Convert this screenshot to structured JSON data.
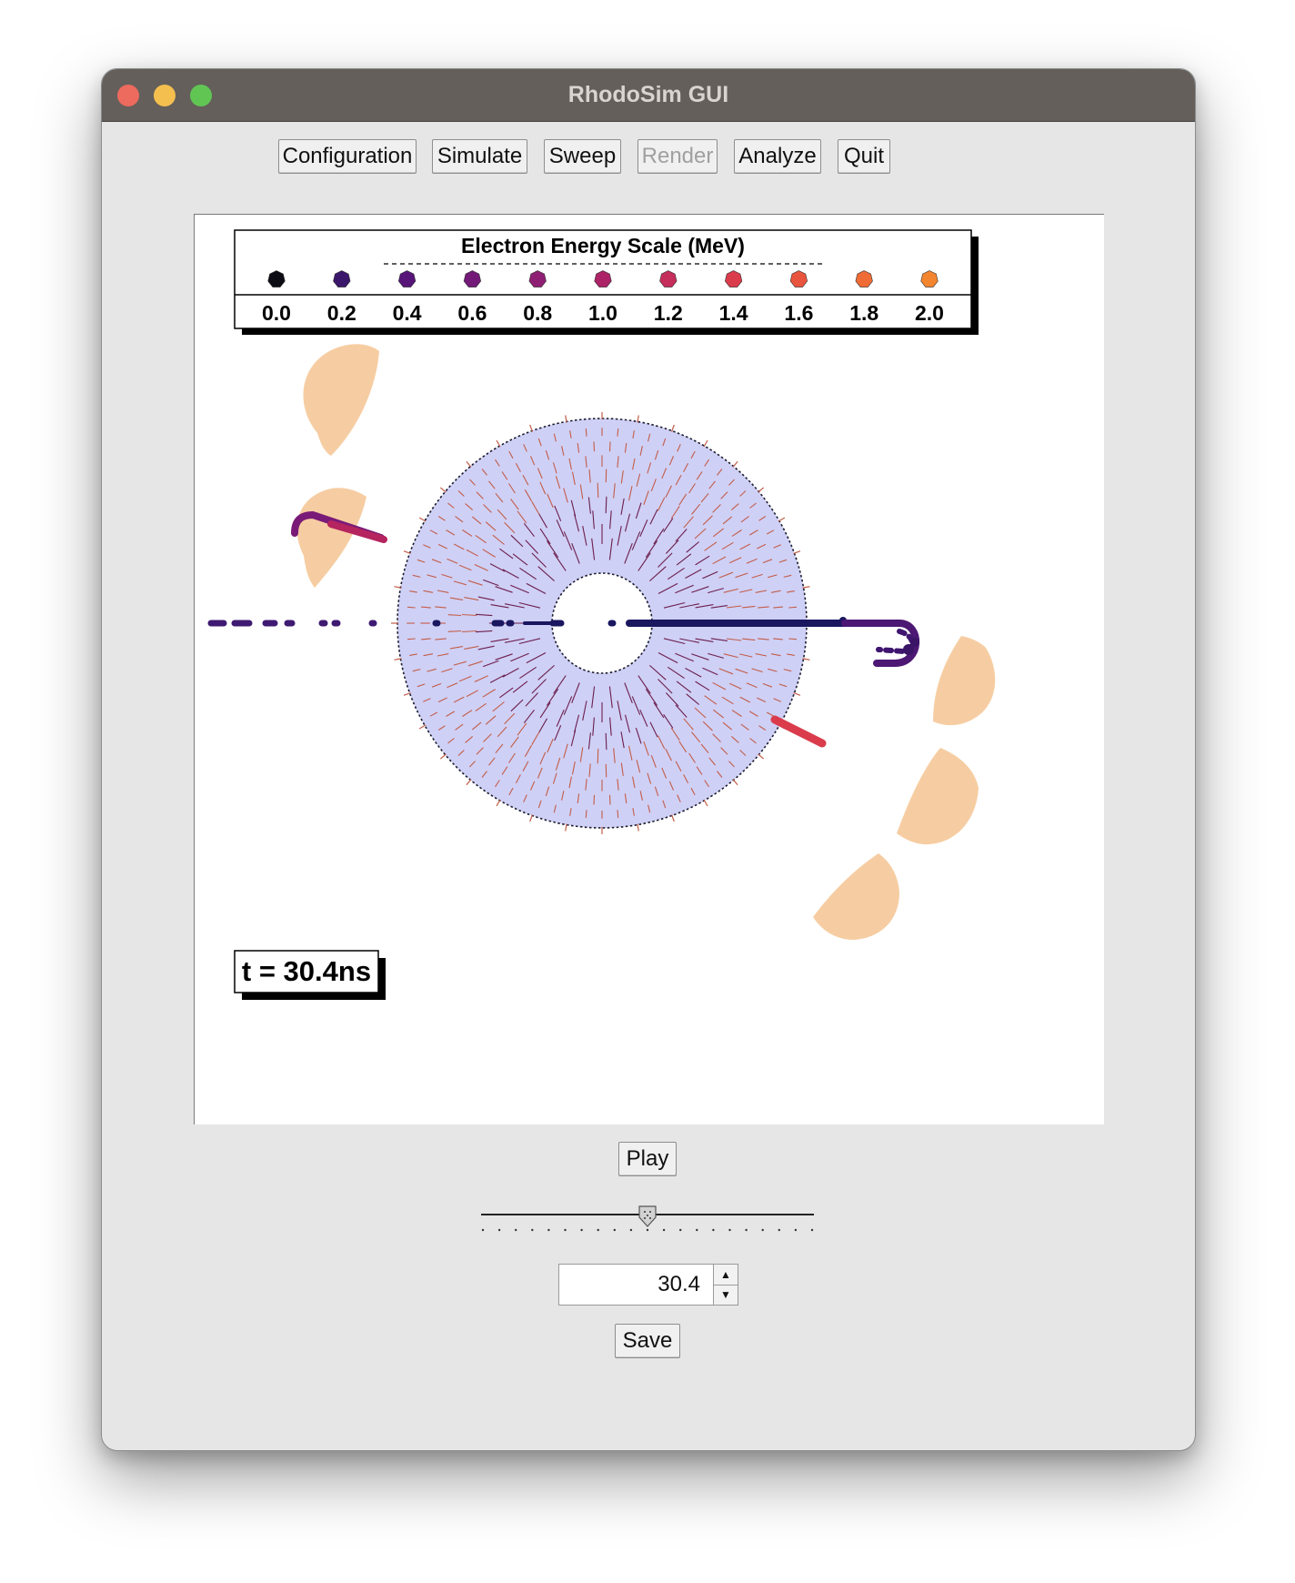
{
  "window": {
    "title": "RhodoSim GUI"
  },
  "toolbar": {
    "configuration_label": "Configuration",
    "simulate_label": "Simulate",
    "sweep_label": "Sweep",
    "render_label": "Render",
    "analyze_label": "Analyze",
    "quit_label": "Quit"
  },
  "plot": {
    "legend": {
      "title": "Electron Energy Scale (MeV)",
      "entries": [
        {
          "label": "0.0",
          "color": "#0c0c14"
        },
        {
          "label": "0.2",
          "color": "#3b176b"
        },
        {
          "label": "0.4",
          "color": "#571479"
        },
        {
          "label": "0.6",
          "color": "#731a78"
        },
        {
          "label": "0.8",
          "color": "#8f1f73"
        },
        {
          "label": "1.0",
          "color": "#ac2467"
        },
        {
          "label": "1.2",
          "color": "#c52d5b"
        },
        {
          "label": "1.4",
          "color": "#da3c4c"
        },
        {
          "label": "1.6",
          "color": "#e9543e"
        },
        {
          "label": "1.8",
          "color": "#f06c36"
        },
        {
          "label": "2.0",
          "color": "#f4852f"
        }
      ]
    },
    "time_label": "t = 30.4ns",
    "colors": {
      "cavity": "#cfd0f6",
      "field_arrow": "#c25d48",
      "field_arrow_inner": "#6b1e4c",
      "magnet": "#f6cda2",
      "beam_main": "#1a1760"
    }
  },
  "controls": {
    "play_label": "Play",
    "time_value": "30.4",
    "time_fraction": 0.5,
    "save_label": "Save"
  }
}
